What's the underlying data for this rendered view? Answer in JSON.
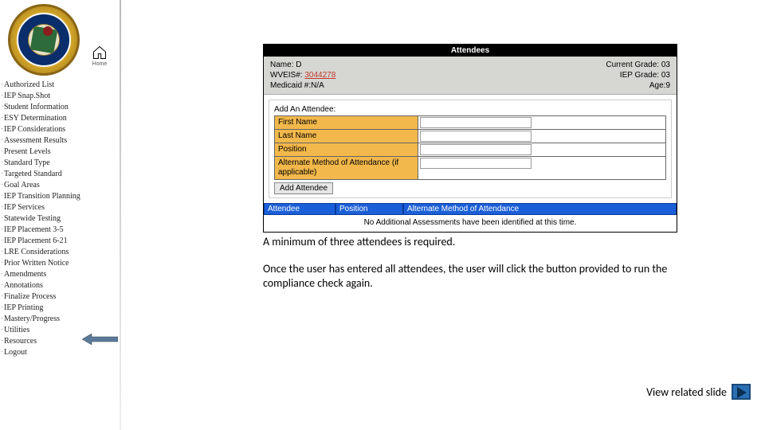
{
  "home_label": "Home",
  "nav": [
    "Authorized List",
    "IEP Snap.Shot",
    "Student Information",
    "ESY Determination",
    "IEP Considerations",
    "Assessment Results",
    "Present Levels",
    "Standard Type",
    "Targeted Standard",
    "Goal Areas",
    "IEP Transition Planning",
    "IEP Services",
    "Statewide Testing",
    "IEP Placement 3-5",
    "IEP Placement 6-21",
    "LRE Considerations",
    "Prior Written Notice",
    "Amendments",
    "Annotations",
    "Finalize Process",
    "IEP Printing",
    "Mastery/Progress",
    "Utilities",
    "Resources",
    "Logout"
  ],
  "panel_title": "Attendees",
  "student": {
    "name_label": "Name:",
    "name_value": "D",
    "wveis_label": "WVEIS#:",
    "wveis_value": "3044278",
    "medicaid_label": "Medicaid #:",
    "medicaid_value": "N/A",
    "current_grade_label": "Current Grade:",
    "current_grade_value": "03",
    "iep_grade_label": "IEP Grade:",
    "iep_grade_value": "03",
    "age_label": "Age:",
    "age_value": "9"
  },
  "form": {
    "title": "Add An Attendee:",
    "first_name": "First Name",
    "last_name": "Last Name",
    "position": "Position",
    "alt_method": "Alternate Method of Attendance (if applicable)",
    "add_btn": "Add Attendee"
  },
  "table": {
    "col_attendee": "Attendee",
    "col_position": "Position",
    "col_alt": "Alternate Method of Attendance",
    "empty_msg": "No Additional Assessments have been identified at this time."
  },
  "note_line1": "A minimum of three attendees is required.",
  "note_line2": "Once the user has entered all attendees, the user will click the button provided to run the compliance check again.",
  "related_label": "View related slide"
}
